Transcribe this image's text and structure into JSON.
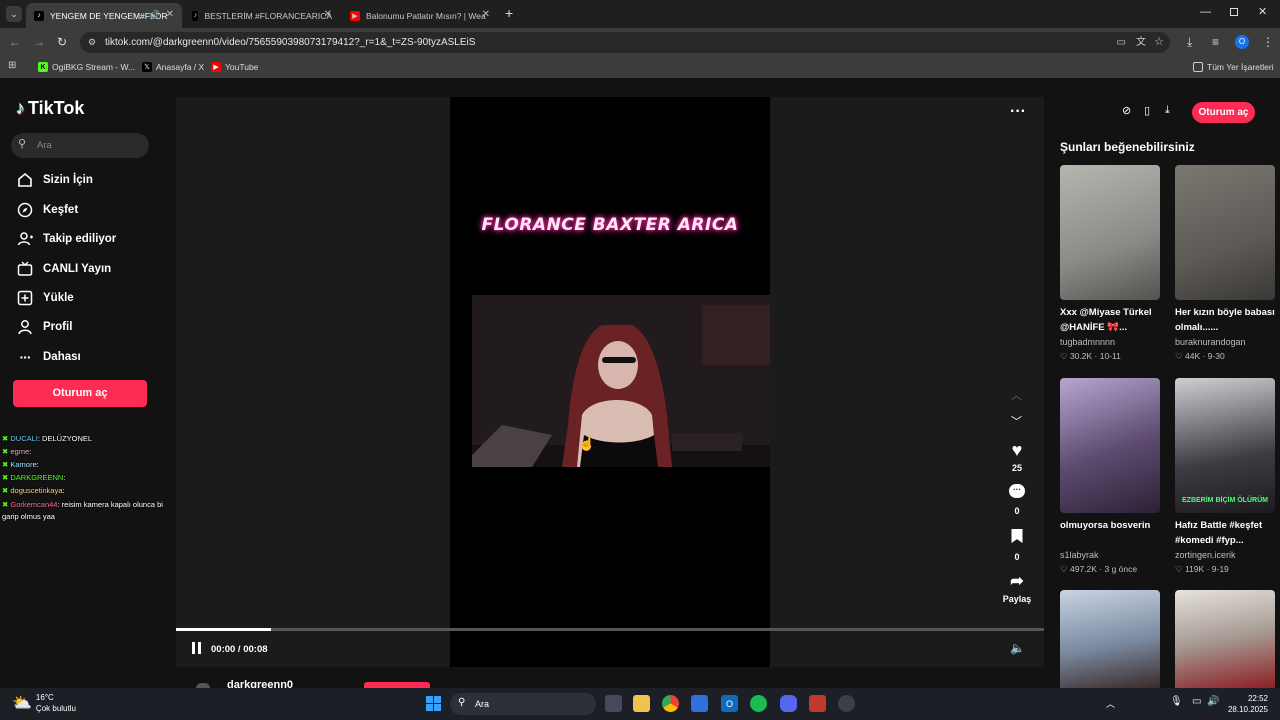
{
  "browser": {
    "tabs": [
      {
        "title": "YENGEM DE YENGEM#FLOR",
        "active": true
      },
      {
        "title": "BESTLERİM #FLORANCEARICA"
      },
      {
        "title": "Balonumu Patlatır Mısın? | Wea"
      }
    ],
    "url": "tiktok.com/@darkgreenn0/video/7565590398073179412?_r=1&_t=ZS-90tyzASLEiS",
    "bookmarks": [
      "OgiBKG Stream - W...",
      "Anasayfa / X",
      "YouTube"
    ],
    "all_bookmarks": "Tüm Yer İşaretleri",
    "profile_letter": "O"
  },
  "sidebar": {
    "logo": "TikTok",
    "search_placeholder": "Ara",
    "nav": [
      {
        "label": "Sizin İçin",
        "icon": "home-icon"
      },
      {
        "label": "Keşfet",
        "icon": "compass-icon"
      },
      {
        "label": "Takip ediliyor",
        "icon": "following-icon"
      },
      {
        "label": "CANLI Yayın",
        "icon": "live-icon"
      },
      {
        "label": "Yükle",
        "icon": "upload-icon"
      },
      {
        "label": "Profil",
        "icon": "profile-icon"
      },
      {
        "label": "Dahası",
        "icon": "more-icon"
      }
    ],
    "login": "Oturum aç"
  },
  "chat": [
    {
      "user": "DUCALI",
      "text": ": DELÜZYONEL"
    },
    {
      "user": "egme",
      "text": ":"
    },
    {
      "user": "Kamore",
      "text": ":"
    },
    {
      "user": "DARKGREENN",
      "text": ":"
    },
    {
      "user": "doguscetinkaya",
      "text": ":"
    },
    {
      "user": "Gorkemcan44",
      "text": ": reisim kamera kapalı olunca bi"
    },
    {
      "user": "",
      "text": "garip olmus yaa"
    }
  ],
  "video": {
    "overlay_title": "FLORANCE BAXTER ARICA",
    "time": "00:00 / 00:08",
    "progress": 0.11,
    "likes": "25",
    "comments": "0",
    "saves": "0",
    "share_label": "Paylaş",
    "author": "darkgreenn0"
  },
  "topright": {
    "login": "Oturum aç"
  },
  "suggestions": {
    "heading": "Şunları beğenebilirsiniz",
    "items": [
      {
        "caption": "Xxx @Miyase Türkel @HANİFE 🎀...",
        "author": "tugbadmnnnn",
        "meta": "30.2K · 10-11",
        "color": "#8a8a86"
      },
      {
        "caption": "Her kızın böyle babası olmalı......",
        "author": "buraknurandogan",
        "meta": "44K · 9-30",
        "color": "#5d5a55"
      },
      {
        "caption": "olmuyorsa bosverin",
        "author": "s1labyrak",
        "meta": "497.2K · 3 g önce",
        "color": "#5b4a6e"
      },
      {
        "caption": "Hafız Battle #keşfet #komedi #fyp...",
        "author": "zortingen.icerik",
        "meta": "119K · 9-19",
        "color": "#3e3b42",
        "badge": "EZBERİM BİÇİM ÖLÜRÜM"
      },
      {
        "caption": "",
        "author": "",
        "meta": "",
        "color": "#7b8aa0"
      },
      {
        "caption": "",
        "author": "",
        "meta": "",
        "color": "#a59a92"
      }
    ]
  },
  "taskbar": {
    "weather_temp": "16°C",
    "weather_desc": "Çok bulutlu",
    "search": "Ara",
    "time": "22:52",
    "date": "28.10.2025"
  }
}
